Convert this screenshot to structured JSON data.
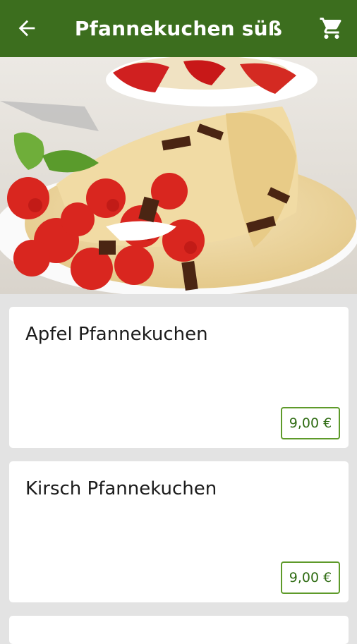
{
  "header": {
    "title": "Pfannekuchen süß",
    "back_icon": "back-arrow-icon",
    "cart_icon": "shopping-cart-icon"
  },
  "hero": {
    "alt": "Pfannekuchen mit Erdbeeren und Schokolade"
  },
  "products": [
    {
      "name": "Apfel Pfannekuchen",
      "price": "9,00 €"
    },
    {
      "name": "Kirsch Pfannekuchen",
      "price": "9,00 €"
    }
  ],
  "colors": {
    "appbar": "#3c6e1e",
    "price_border": "#5e9a2a",
    "price_text": "#2e6b12",
    "background": "#e3e3e3"
  }
}
